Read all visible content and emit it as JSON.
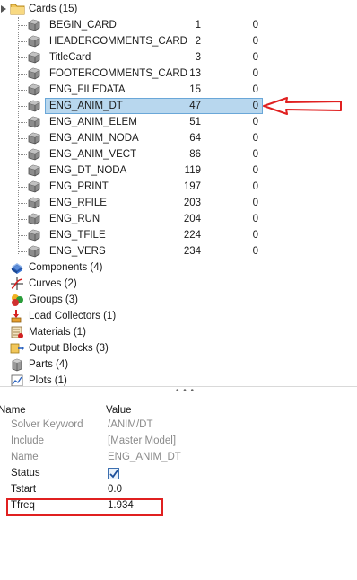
{
  "tree": {
    "cards_label": "Cards (15)",
    "cards": [
      {
        "name": "BEGIN_CARD",
        "id": "1",
        "val": "0"
      },
      {
        "name": "HEADERCOMMENTS_CARD",
        "id": "2",
        "val": "0"
      },
      {
        "name": "TitleCard",
        "id": "3",
        "val": "0"
      },
      {
        "name": "FOOTERCOMMENTS_CARD",
        "id": "13",
        "val": "0"
      },
      {
        "name": "ENG_FILEDATA",
        "id": "15",
        "val": "0"
      },
      {
        "name": "ENG_ANIM_DT",
        "id": "47",
        "val": "0"
      },
      {
        "name": "ENG_ANIM_ELEM",
        "id": "51",
        "val": "0"
      },
      {
        "name": "ENG_ANIM_NODA",
        "id": "64",
        "val": "0"
      },
      {
        "name": "ENG_ANIM_VECT",
        "id": "86",
        "val": "0"
      },
      {
        "name": "ENG_DT_NODA",
        "id": "119",
        "val": "0"
      },
      {
        "name": "ENG_PRINT",
        "id": "197",
        "val": "0"
      },
      {
        "name": "ENG_RFILE",
        "id": "203",
        "val": "0"
      },
      {
        "name": "ENG_RUN",
        "id": "204",
        "val": "0"
      },
      {
        "name": "ENG_TFILE",
        "id": "224",
        "val": "0"
      },
      {
        "name": "ENG_VERS",
        "id": "234",
        "val": "0"
      }
    ],
    "selected_index": 5,
    "categories": [
      {
        "label": "Components (4)",
        "icon": "components-icon"
      },
      {
        "label": "Curves (2)",
        "icon": "curves-icon"
      },
      {
        "label": "Groups (3)",
        "icon": "groups-icon"
      },
      {
        "label": "Load Collectors (1)",
        "icon": "load-collectors-icon"
      },
      {
        "label": "Materials (1)",
        "icon": "materials-icon"
      },
      {
        "label": "Output Blocks (3)",
        "icon": "output-blocks-icon"
      },
      {
        "label": "Parts (4)",
        "icon": "parts-icon"
      },
      {
        "label": "Plots (1)",
        "icon": "plots-icon"
      }
    ]
  },
  "splitter": {
    "dots": "• • •"
  },
  "properties": {
    "header_name": "Name",
    "header_value": "Value",
    "rows": [
      {
        "key": "Solver Keyword",
        "value": "/ANIM/DT"
      },
      {
        "key": "Include",
        "value": "[Master Model]"
      },
      {
        "key": "Name",
        "value": "ENG_ANIM_DT"
      },
      {
        "key": "Status",
        "value": ""
      },
      {
        "key": "Tstart",
        "value": "0.0"
      },
      {
        "key": "Tfreq",
        "value": "1.934"
      }
    ],
    "status_checked": true
  },
  "colors": {
    "selection": "#b8d7ee",
    "highlight_box": "#e02020",
    "arrow": "#e02020"
  }
}
